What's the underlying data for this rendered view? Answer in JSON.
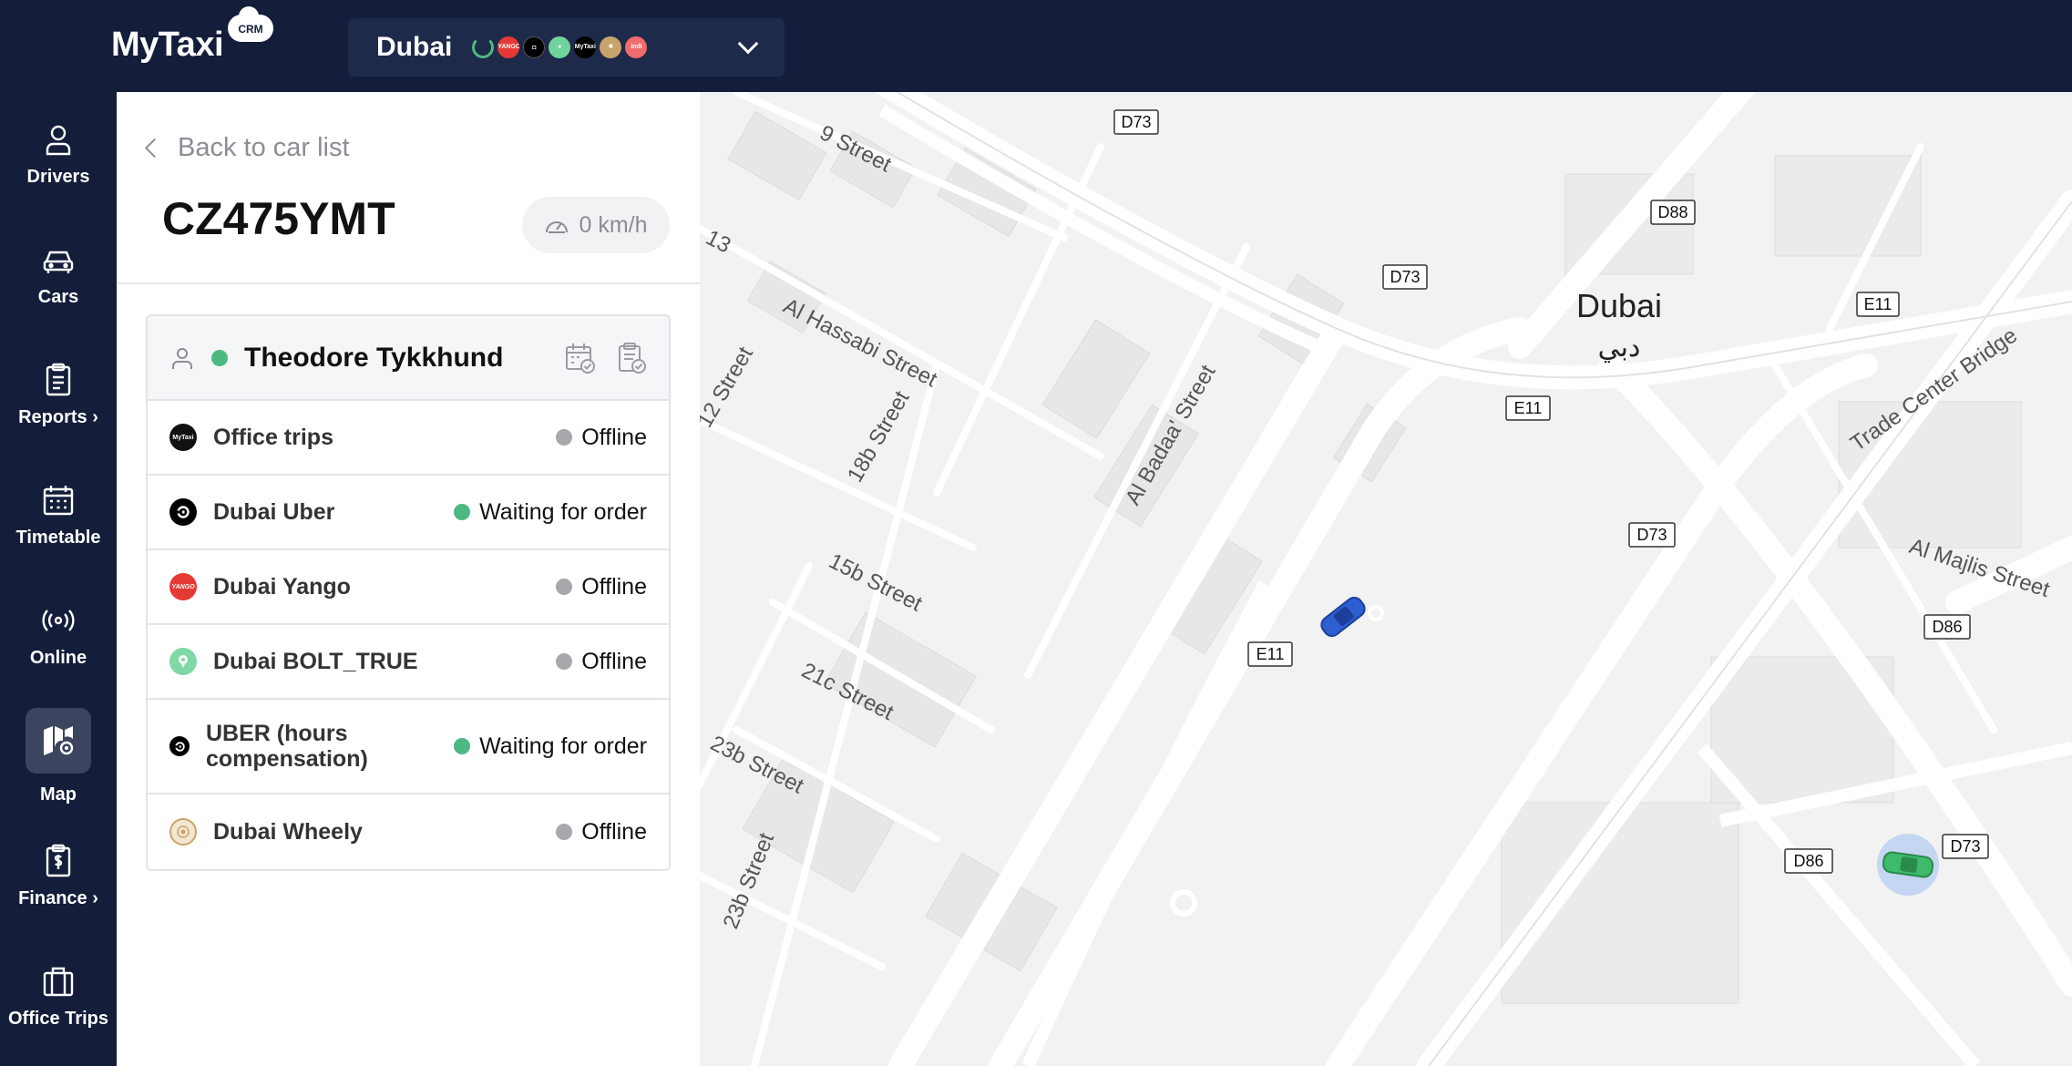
{
  "app": {
    "logo_text": "MyTaxi",
    "logo_badge": "CRM"
  },
  "city_selector": {
    "city": "Dubai",
    "aggregators": [
      "bolt-icon",
      "yango-icon",
      "uber-icon",
      "bolt-true-icon",
      "mytaxi-icon",
      "wheely-icon",
      "indrive-icon"
    ]
  },
  "sidebar": {
    "items": [
      {
        "label": "Drivers",
        "icon": "person-icon"
      },
      {
        "label": "Cars",
        "icon": "car-icon"
      },
      {
        "label": "Reports",
        "icon": "clipboard-icon"
      },
      {
        "label": "Timetable",
        "icon": "calendar-icon"
      },
      {
        "label": "Online",
        "icon": "broadcast-icon"
      },
      {
        "label": "Map",
        "icon": "map-icon",
        "active": true
      },
      {
        "label": "Finance",
        "icon": "finance-icon"
      },
      {
        "label": "Office Trips",
        "icon": "briefcase-icon"
      }
    ]
  },
  "panel": {
    "back_label": "Back to car list",
    "plate": "CZ475YMT",
    "speed": "0 km/h",
    "driver": {
      "name": "Theodore Tykkhund",
      "status_color": "#4cb882"
    },
    "rows": [
      {
        "name": "Office trips",
        "status": "Offline",
        "logo": "mytaxi-logo",
        "logo_text": "MyTaxi"
      },
      {
        "name": "Dubai Uber",
        "status": "Waiting for order",
        "logo": "uber-logo",
        "logo_text": ""
      },
      {
        "name": "Dubai Yango",
        "status": "Offline",
        "logo": "yango-logo",
        "logo_text": "YANGO"
      },
      {
        "name": "Dubai BOLT_TRUE",
        "status": "Offline",
        "logo": "bolt-true-logo",
        "logo_text": ""
      },
      {
        "name": "UBER (hours compensation)",
        "status": "Waiting for order",
        "logo": "uber-logo",
        "logo_text": ""
      },
      {
        "name": "Dubai Wheely",
        "status": "Offline",
        "logo": "wheely-logo",
        "logo_text": ""
      }
    ]
  },
  "map": {
    "city_label": "Dubai",
    "city_label_ar": "دبي",
    "road_shields": [
      "D73",
      "D88",
      "D73",
      "E11",
      "E11",
      "D73",
      "E11",
      "D86",
      "D86",
      "D73"
    ],
    "streets": [
      "9 Street",
      "Al Hassabi Street",
      "18b Street",
      "Al Badaa' Street",
      "15b Street",
      "21c Street",
      "23b Street",
      "23b Street",
      "Trade Center Bridge",
      "Al Majlis Street",
      "12 Street",
      "13"
    ],
    "colors": {
      "background": "#f2f2f2",
      "road": "#ffffff",
      "block": "#e6e6e6",
      "car_blue": "#2d5fd3",
      "car_green": "#3dba6a"
    }
  }
}
